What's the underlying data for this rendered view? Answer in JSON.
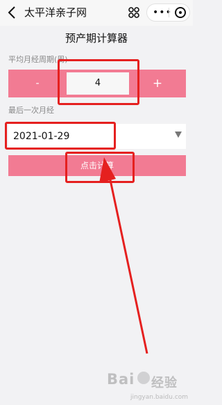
{
  "topbar": {
    "title": "太平洋亲子网",
    "more_glyph": "•••"
  },
  "main": {
    "heading": "预产期计算器",
    "cycle_label": "平均月经周期(周)",
    "minus_label": "-",
    "cycle_value": "4",
    "plus_label": "+",
    "last_period_label": "最后一次月经",
    "last_period_value": "2021-01-29",
    "calc_button": "点击计算"
  },
  "watermark": {
    "brand": "Bai",
    "brand2": "经验",
    "domain": "jingyan.baidu.com"
  },
  "colors": {
    "accent": "#f27b93",
    "annotation": "#e5201f"
  }
}
